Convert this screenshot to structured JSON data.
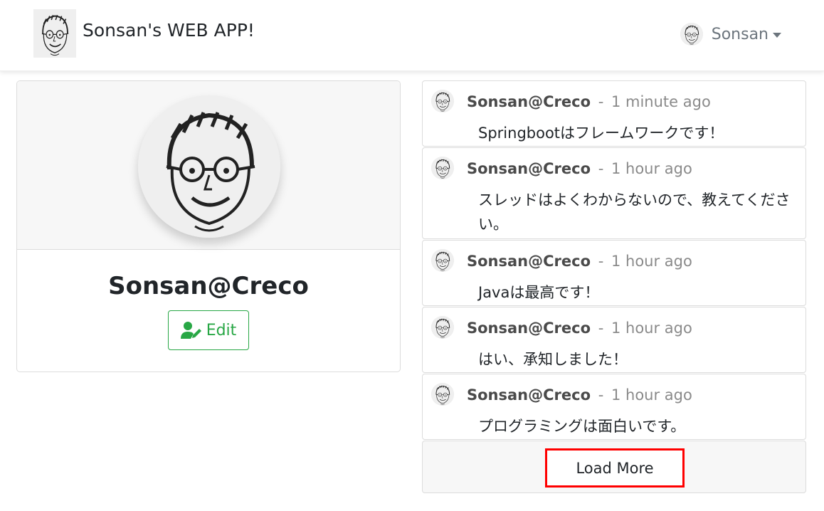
{
  "navbar": {
    "brand_title": "Sonsan's WEB APP!",
    "user_name": "Sonsan"
  },
  "profile": {
    "name": "Sonsan@Creco",
    "edit_label": "Edit"
  },
  "posts": [
    {
      "author": "Sonsan@Creco",
      "separator": "-",
      "time": "1 minute ago",
      "body": "Springbootはフレームワークです！"
    },
    {
      "author": "Sonsan@Creco",
      "separator": "-",
      "time": "1 hour ago",
      "body": "スレッドはよくわからないので、教えてください。"
    },
    {
      "author": "Sonsan@Creco",
      "separator": "-",
      "time": "1 hour ago",
      "body": "Javaは最高です！"
    },
    {
      "author": "Sonsan@Creco",
      "separator": "-",
      "time": "1 hour ago",
      "body": "はい、承知しました！"
    },
    {
      "author": "Sonsan@Creco",
      "separator": "-",
      "time": "1 hour ago",
      "body": "プログラミングは面白いです。"
    }
  ],
  "load_more_label": "Load More",
  "colors": {
    "success": "#28a745",
    "highlight": "#ff0000",
    "muted": "#6c757d"
  },
  "icons": [
    "face-sketch-icon",
    "chevron-down-icon",
    "user-edit-icon"
  ]
}
